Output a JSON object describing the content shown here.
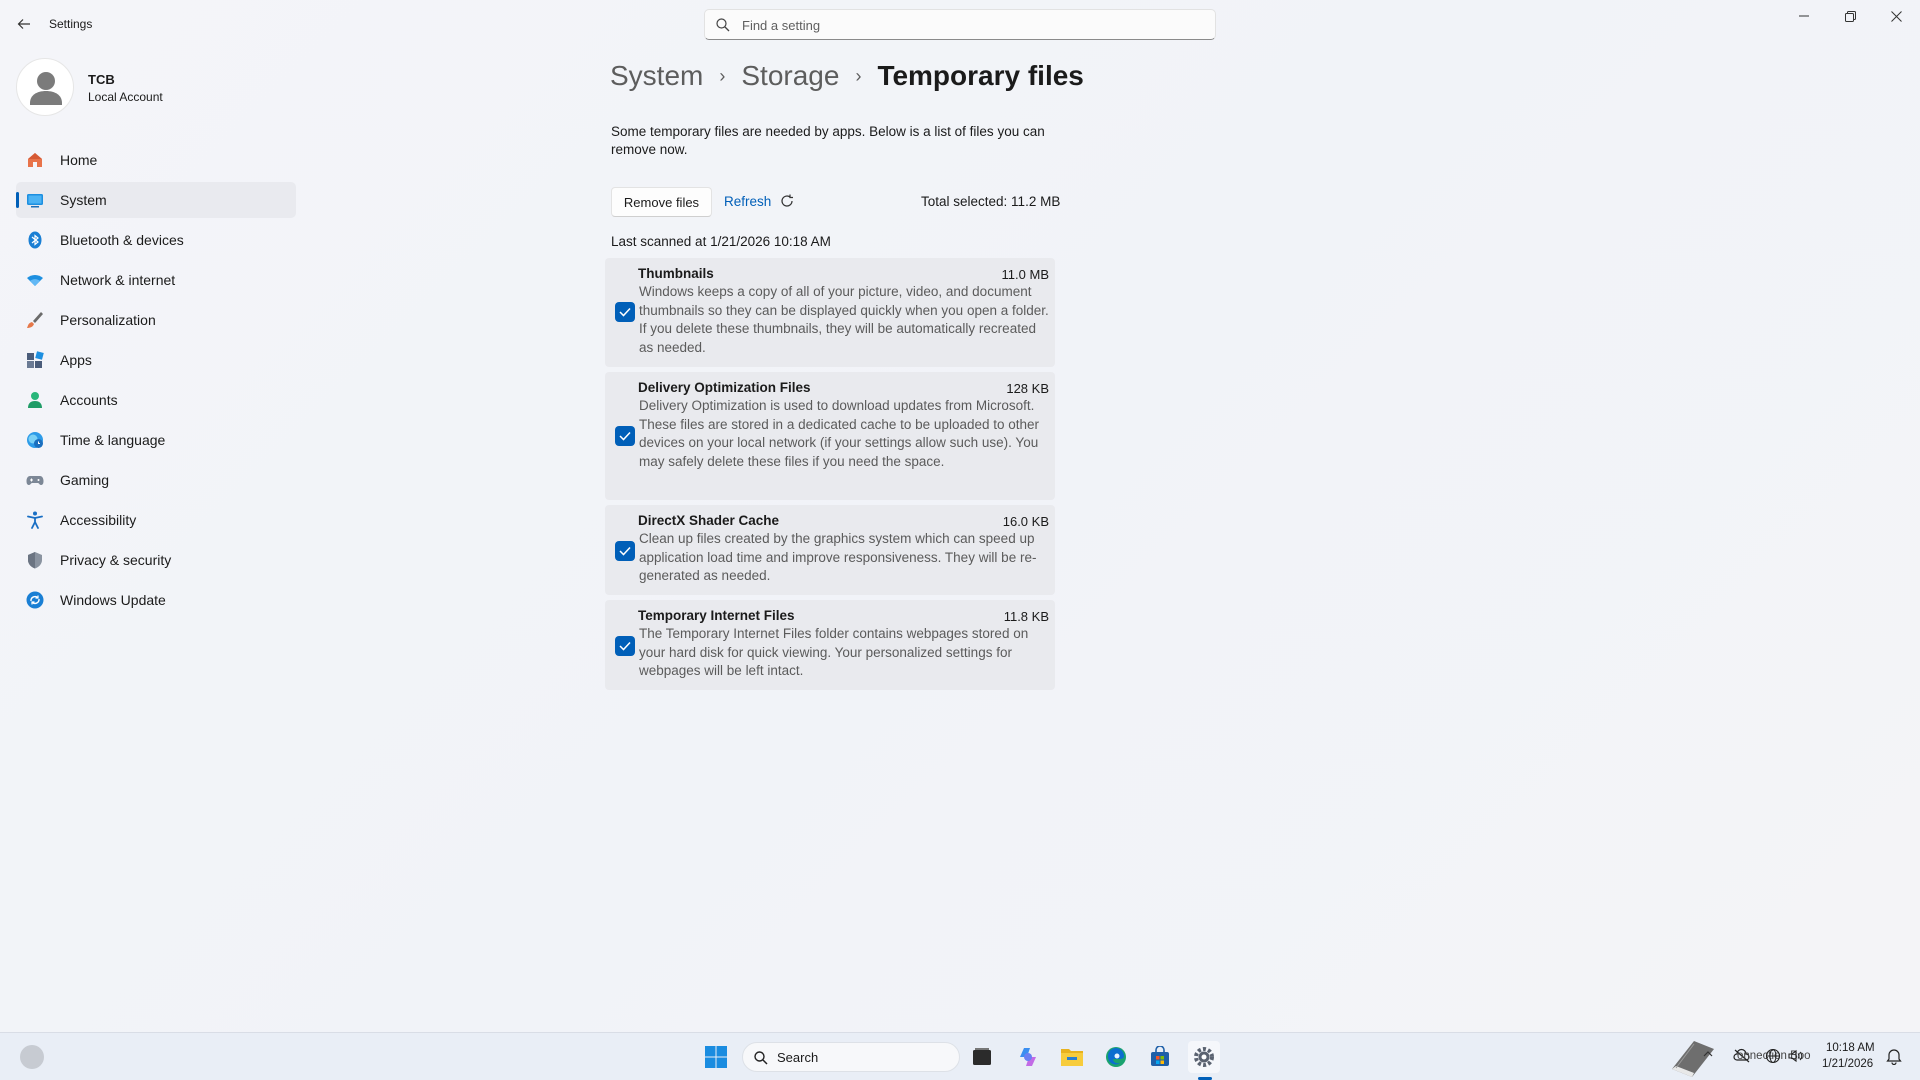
{
  "window": {
    "app_title": "Settings",
    "search_placeholder": "Find a setting",
    "controls": {
      "minimize": "–",
      "restore": "❐",
      "close": "✕"
    }
  },
  "profile": {
    "name": "TCB",
    "subtitle": "Local Account"
  },
  "nav": {
    "items": [
      {
        "label": "Home",
        "icon": "home-icon"
      },
      {
        "label": "System",
        "icon": "system-icon",
        "active": true
      },
      {
        "label": "Bluetooth & devices",
        "icon": "bluetooth-icon"
      },
      {
        "label": "Network & internet",
        "icon": "wifi-icon"
      },
      {
        "label": "Personalization",
        "icon": "brush-icon"
      },
      {
        "label": "Apps",
        "icon": "apps-icon"
      },
      {
        "label": "Accounts",
        "icon": "person-icon"
      },
      {
        "label": "Time & language",
        "icon": "globe-clock-icon"
      },
      {
        "label": "Gaming",
        "icon": "gamepad-icon"
      },
      {
        "label": "Accessibility",
        "icon": "accessibility-icon"
      },
      {
        "label": "Privacy & security",
        "icon": "shield-icon"
      },
      {
        "label": "Windows Update",
        "icon": "update-icon"
      }
    ]
  },
  "breadcrumb": {
    "part1": "System",
    "part2": "Storage",
    "current": "Temporary files",
    "separator": "›"
  },
  "main": {
    "intro": "Some temporary files are needed by apps. Below is a list of files you can remove now.",
    "remove_label": "Remove files",
    "refresh_label": "Refresh",
    "total_selected": "Total selected: 11.2 MB",
    "last_scanned": "Last scanned at 1/21/2026 10:18 AM",
    "files": [
      {
        "name": "Thumbnails",
        "size": "11.0 MB",
        "checked": true,
        "desc": "Windows keeps a copy of all of your picture, video, and document thumbnails so they can be displayed quickly when you open a folder. If you delete these thumbnails, they will be automatically recreated as needed."
      },
      {
        "name": "Delivery Optimization Files",
        "size": "128 KB",
        "checked": true,
        "desc": "Delivery Optimization is used to download updates from Microsoft. These files are stored in a dedicated cache to be uploaded to other devices on your local network (if your settings allow such use). You may safely delete these files if you need the space."
      },
      {
        "name": "DirectX Shader Cache",
        "size": "16.0 KB",
        "checked": true,
        "desc": "Clean up files created by the graphics system which can speed up application load time and improve responsiveness. They will be re-generated as needed."
      },
      {
        "name": "Temporary Internet Files",
        "size": "11.8 KB",
        "checked": true,
        "desc": "The Temporary Internet Files folder contains webpages stored on your hard disk for quick viewing. Your personalized settings for webpages will be left intact."
      }
    ]
  },
  "taskbar": {
    "search_label": "Search",
    "time": "10:18 AM",
    "date": "1/21/2026",
    "tray_overlay_text": "onnection Boo",
    "accent": "#005fb8"
  }
}
